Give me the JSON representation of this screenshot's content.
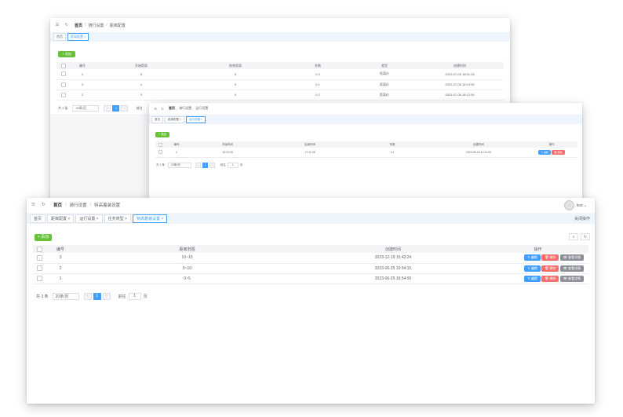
{
  "win1": {
    "breadcrumb": [
      "首页",
      "骑行设置",
      "距离配置"
    ],
    "tabs": [
      "首页",
      "距离配置 ×"
    ],
    "add_label": "+ 添加",
    "columns": [
      "",
      "编号",
      "开始距离",
      "结束距离",
      "系数",
      "类型",
      "创建时间"
    ],
    "rows": [
      [
        "",
        "4",
        "5",
        "5",
        "0.3",
        "距离价",
        "2023-07-06 18:51:28"
      ],
      [
        "",
        "3",
        "1",
        "3",
        "0.1",
        "距离价",
        "2023-07-06 18:14:05"
      ],
      [
        "",
        "2",
        "3",
        "4",
        "0.2",
        "距离价",
        "2023-07-06 18:12:54"
      ]
    ],
    "pager": {
      "total": "共 3 条",
      "page_size": "20条/页",
      "prev": "<",
      "page": "1",
      "next": ">",
      "goto": "前往"
    }
  },
  "win2": {
    "breadcrumb": [
      "首页",
      "骑行设置",
      "运行设置"
    ],
    "tabs": [
      "首页",
      "距离配置 ×",
      "运行设置 ×"
    ],
    "add_label": "+ 添加",
    "columns": [
      "",
      "编号",
      "开始时间",
      "结束时间",
      "系数",
      "创建时间",
      "操作"
    ],
    "rows": [
      [
        "",
        "2",
        "16:15:39",
        "17:11:06",
        "0.1",
        "2023-05-24 17:12:20"
      ]
    ],
    "actions": {
      "edit": "编辑",
      "delete": "删除"
    },
    "pager": {
      "total": "共 1 条",
      "page_size": "20条/页",
      "prev": "<",
      "page": "1",
      "next": ">",
      "goto": "前往",
      "goto_value": "1",
      "page_suffix": "页"
    }
  },
  "win3": {
    "breadcrumb": [
      "首页",
      "骑行设置",
      "特高着装设置"
    ],
    "user": "test",
    "close_all": "关闭操作",
    "tabs": [
      "首页",
      "距离配置 ×",
      "运行设置 ×",
      "任务类型 ×",
      "特高着装设置 ×"
    ],
    "add_label": "+ 添加",
    "columns": [
      "",
      "编号",
      "距离范围",
      "创建时间",
      "操作"
    ],
    "rows": [
      [
        "",
        "3",
        "10~15",
        "2023-12-19 15:42:24"
      ],
      [
        "",
        "2",
        "5~10",
        "2023-06-25 10:54:10"
      ],
      [
        "",
        "1",
        "0~5",
        "2023-06-25 10:54:00"
      ]
    ],
    "actions": {
      "edit": "编辑",
      "delete": "删除",
      "view": "查看详情"
    },
    "pager": {
      "total": "共 3 条",
      "page_size": "20条/页",
      "prev": "<",
      "page": "1",
      "next": ">",
      "goto": "前往",
      "goto_value": "1",
      "page_suffix": "页"
    }
  }
}
